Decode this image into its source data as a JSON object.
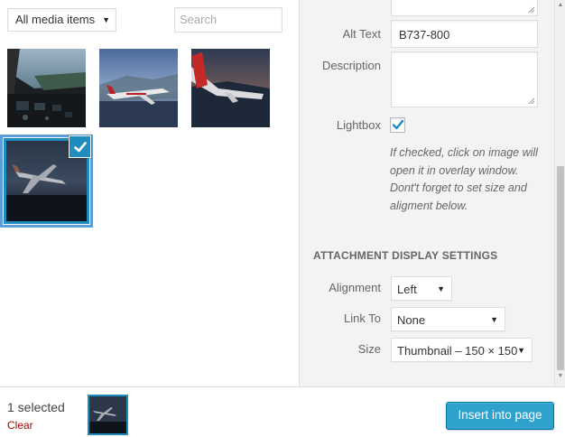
{
  "media_browser": {
    "filter": {
      "selected": "All media items"
    },
    "search": {
      "placeholder": "Search"
    },
    "items": [
      {
        "icon": "cockpit-photo",
        "selected": false
      },
      {
        "icon": "airliner-flight-photo",
        "selected": false
      },
      {
        "icon": "wing-sunset-photo",
        "selected": false
      },
      {
        "icon": "airliner-night-photo",
        "selected": true
      }
    ]
  },
  "details": {
    "alt_text": {
      "label": "Alt Text",
      "value": "B737-800"
    },
    "description": {
      "label": "Description",
      "value": ""
    },
    "lightbox": {
      "label": "Lightbox",
      "checked": true
    },
    "help_text": "If checked, click on image will open it in overlay window. Dont't forget to set size and aligment below."
  },
  "display_settings": {
    "title": "Attachment Display Settings",
    "alignment": {
      "label": "Alignment",
      "value": "Left"
    },
    "link_to": {
      "label": "Link To",
      "value": "None"
    },
    "size": {
      "label": "Size",
      "value": "Thumbnail – 150 × 150"
    }
  },
  "toolbar": {
    "selected_count": "1 selected",
    "clear_label": "Clear",
    "insert_label": "Insert into page"
  },
  "colors": {
    "accent": "#1e8cbe",
    "button": "#2ea2cc",
    "clear_link": "#aa0000"
  }
}
